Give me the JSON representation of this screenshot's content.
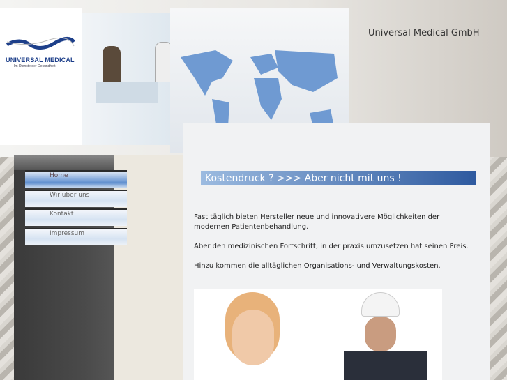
{
  "header": {
    "logo_text": "UNIVERSAL MEDICAL",
    "logo_tagline": "Im Dienste der Gesundheit",
    "company": "Universal Medical GmbH"
  },
  "nav": [
    {
      "label": "Home",
      "active": true
    },
    {
      "label": "Wir über uns"
    },
    {
      "label": "Kontakt"
    },
    {
      "label": "Impressum"
    }
  ],
  "main": {
    "headline": "Kostendruck ? >>> Aber nicht mit uns !",
    "paragraphs": [
      "Fast täglich bieten Hersteller neue und innovativere Möglichkeiten der modernen Patientenbehandlung.",
      "Aber den medizinischen Fortschritt, in der praxis umzusetzen hat seinen Preis.",
      "Hinzu kommen die alltäglichen Organisations- und Verwaltungskosten."
    ]
  }
}
